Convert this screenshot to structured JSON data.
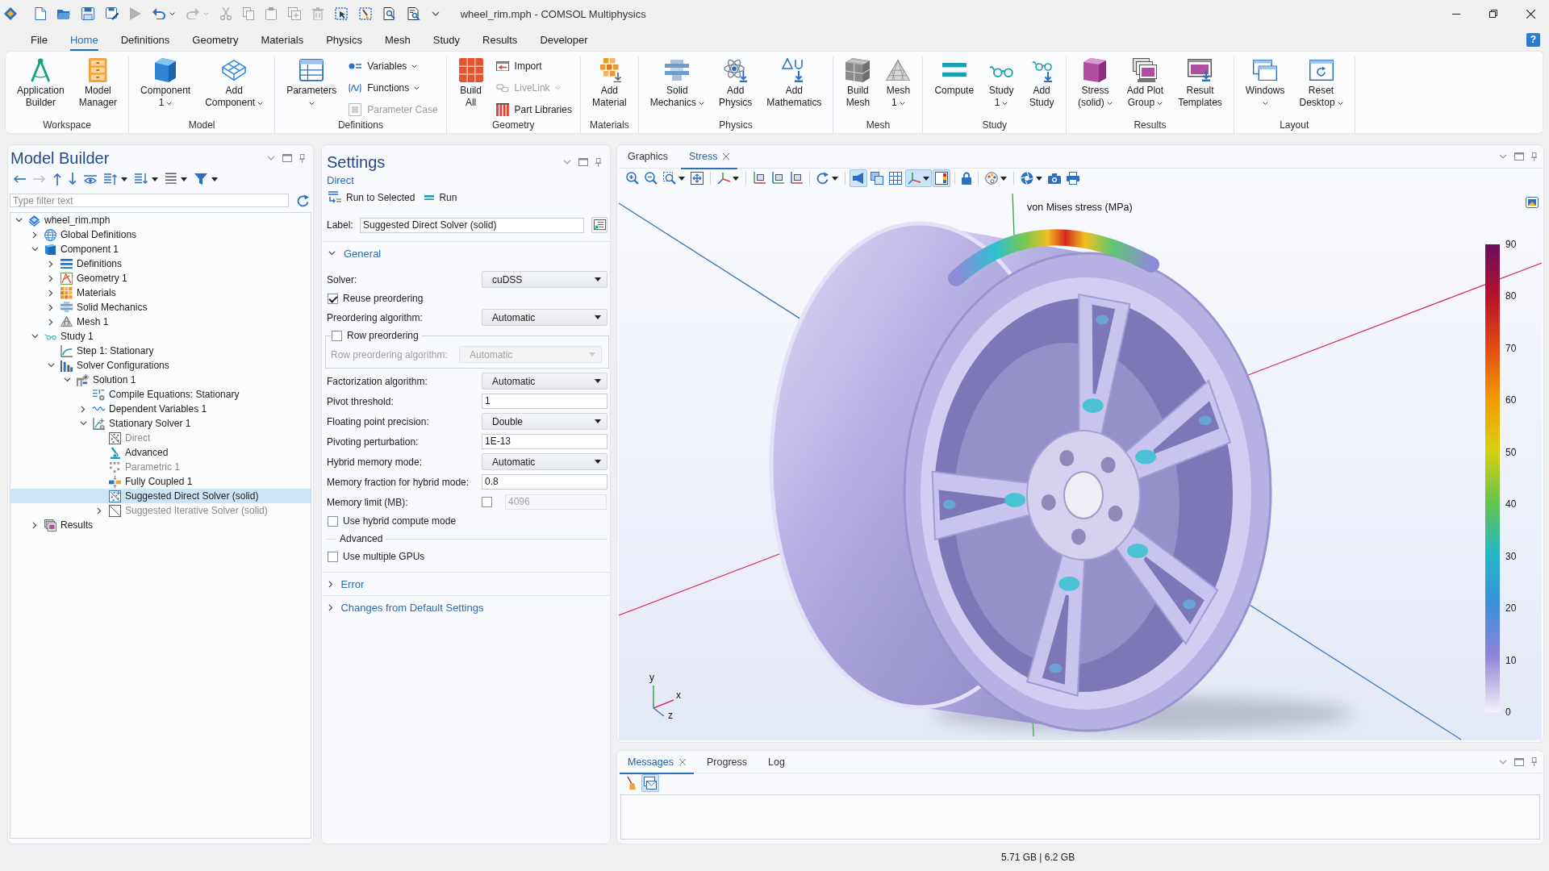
{
  "window": {
    "title": "wheel_rim.mph - COMSOL Multiphysics"
  },
  "quick_access": [
    {
      "kind": "new",
      "disabled": false
    },
    {
      "kind": "open",
      "disabled": false
    },
    {
      "kind": "save",
      "disabled": false
    },
    {
      "kind": "save_as",
      "disabled": false
    },
    {
      "kind": "run",
      "disabled": true
    },
    {
      "kind": "undo",
      "disabled": false,
      "menu": true
    },
    {
      "kind": "redo",
      "disabled": true,
      "menu": true
    },
    {
      "kind": "cut",
      "disabled": true
    },
    {
      "kind": "copy",
      "disabled": true
    },
    {
      "kind": "paste",
      "disabled": true
    },
    {
      "kind": "duplicate",
      "disabled": true
    },
    {
      "kind": "delete",
      "disabled": true
    },
    {
      "kind": "select_box",
      "disabled": false
    },
    {
      "kind": "brush_box",
      "disabled": false
    },
    {
      "kind": "find",
      "disabled": false
    },
    {
      "kind": "find_list",
      "disabled": false
    },
    {
      "kind": "customize",
      "disabled": false
    }
  ],
  "menu_tabs": [
    {
      "label": "File",
      "selected": false
    },
    {
      "label": "Home",
      "selected": true
    },
    {
      "label": "Definitions",
      "selected": false
    },
    {
      "label": "Geometry",
      "selected": false
    },
    {
      "label": "Materials",
      "selected": false
    },
    {
      "label": "Physics",
      "selected": false
    },
    {
      "label": "Mesh",
      "selected": false
    },
    {
      "label": "Study",
      "selected": false
    },
    {
      "label": "Results",
      "selected": false
    },
    {
      "label": "Developer",
      "selected": false
    }
  ],
  "help": "?",
  "ribbon": {
    "groups": [
      {
        "label": "Workspace",
        "buttons": [
          {
            "kind": "app_builder",
            "lines": [
              "Application",
              "Builder"
            ]
          },
          {
            "kind": "model_manager",
            "lines": [
              "Model",
              "Manager"
            ]
          }
        ]
      },
      {
        "label": "Model",
        "buttons": [
          {
            "kind": "component",
            "lines": [
              "Component",
              "1"
            ],
            "menu": true
          },
          {
            "kind": "add_component",
            "lines": [
              "Add",
              "Component"
            ],
            "menu": true
          }
        ]
      },
      {
        "label": "Definitions",
        "buttons": [
          {
            "kind": "parameters",
            "lines": [
              "Parameters"
            ],
            "menu": true
          }
        ],
        "small": [
          {
            "kind": "variables",
            "label": "Variables",
            "menu": true,
            "disabled": false
          },
          {
            "kind": "functions",
            "label": "Functions",
            "menu": true,
            "disabled": false
          },
          {
            "kind": "parameter_case",
            "label": "Parameter Case",
            "disabled": true
          }
        ]
      },
      {
        "label": "Geometry",
        "buttons": [
          {
            "kind": "build_all",
            "lines": [
              "Build",
              "All"
            ]
          }
        ],
        "small": [
          {
            "kind": "import",
            "label": "Import",
            "disabled": false
          },
          {
            "kind": "livelink",
            "label": "LiveLink",
            "menu": true,
            "disabled": true
          },
          {
            "kind": "part_libraries",
            "label": "Part Libraries",
            "disabled": false
          }
        ]
      },
      {
        "label": "Materials",
        "buttons": [
          {
            "kind": "add_material",
            "lines": [
              "Add",
              "Material"
            ]
          }
        ]
      },
      {
        "label": "Physics",
        "buttons": [
          {
            "kind": "solid_mechanics",
            "lines": [
              "Solid",
              "Mechanics"
            ],
            "menu": true
          },
          {
            "kind": "add_physics",
            "lines": [
              "Add",
              "Physics"
            ]
          },
          {
            "kind": "add_mathematics",
            "lines": [
              "Add",
              "Mathematics"
            ]
          }
        ]
      },
      {
        "label": "Mesh",
        "buttons": [
          {
            "kind": "build_mesh",
            "lines": [
              "Build",
              "Mesh"
            ]
          },
          {
            "kind": "mesh",
            "lines": [
              "Mesh",
              "1"
            ],
            "menu": true
          }
        ]
      },
      {
        "label": "Study",
        "buttons": [
          {
            "kind": "compute",
            "lines": [
              "Compute"
            ]
          },
          {
            "kind": "study",
            "lines": [
              "Study",
              "1"
            ],
            "menu": true
          },
          {
            "kind": "add_study",
            "lines": [
              "Add",
              "Study"
            ]
          }
        ]
      },
      {
        "label": "Results",
        "buttons": [
          {
            "kind": "plot_group",
            "lines": [
              "Stress",
              "(solid)"
            ],
            "menu": true
          },
          {
            "kind": "add_plot_group",
            "lines": [
              "Add Plot",
              "Group"
            ],
            "menu": true
          },
          {
            "kind": "result_templates",
            "lines": [
              "Result",
              "Templates"
            ]
          }
        ]
      },
      {
        "label": "Layout",
        "buttons": [
          {
            "kind": "windows",
            "lines": [
              "Windows"
            ],
            "menu": true
          },
          {
            "kind": "reset_desktop",
            "lines": [
              "Reset",
              "Desktop"
            ],
            "menu": true
          }
        ]
      }
    ]
  },
  "model_builder": {
    "title": "Model Builder",
    "toolbar": [
      {
        "kind": "back",
        "disabled": false
      },
      {
        "kind": "forward",
        "disabled": true
      },
      {
        "kind": "move_up",
        "disabled": false
      },
      {
        "kind": "move_down",
        "disabled": false
      },
      {
        "kind": "show",
        "disabled": false
      },
      {
        "kind": "collapse",
        "disabled": false,
        "menu": true
      },
      {
        "kind": "expand",
        "disabled": false,
        "menu": true
      },
      {
        "kind": "list",
        "disabled": false,
        "menu": true
      },
      {
        "kind": "filter",
        "disabled": false,
        "menu": true
      }
    ],
    "filter": {
      "placeholder": "Type filter text"
    },
    "tree": [
      {
        "label": "wheel_rim.mph",
        "kind": "root",
        "expanded": true,
        "selected": false,
        "disabled": false,
        "children": [
          {
            "label": "Global Definitions",
            "kind": "global",
            "expanded": false,
            "selected": false,
            "disabled": false
          },
          {
            "label": "Component 1",
            "kind": "component",
            "expanded": true,
            "selected": false,
            "disabled": false,
            "children": [
              {
                "label": "Definitions",
                "kind": "definitions",
                "expanded": false,
                "selected": false,
                "disabled": false
              },
              {
                "label": "Geometry 1",
                "kind": "geometry",
                "expanded": false,
                "selected": false,
                "disabled": false
              },
              {
                "label": "Materials",
                "kind": "materials",
                "expanded": false,
                "selected": false,
                "disabled": false
              },
              {
                "label": "Solid Mechanics",
                "kind": "physics",
                "expanded": false,
                "selected": false,
                "disabled": false
              },
              {
                "label": "Mesh 1",
                "kind": "mesh",
                "expanded": false,
                "selected": false,
                "disabled": false
              }
            ]
          },
          {
            "label": "Study 1",
            "kind": "study",
            "expanded": true,
            "selected": false,
            "disabled": false,
            "children": [
              {
                "label": "Step 1: Stationary",
                "kind": "step",
                "selected": false,
                "disabled": false
              },
              {
                "label": "Solver Configurations",
                "kind": "solver_configurations",
                "expanded": true,
                "selected": false,
                "disabled": false,
                "children": [
                  {
                    "label": "Solution 1",
                    "kind": "solution",
                    "expanded": true,
                    "selected": false,
                    "disabled": false,
                    "children": [
                      {
                        "label": "Compile Equations: Stationary",
                        "kind": "compile",
                        "selected": false,
                        "disabled": false
                      },
                      {
                        "label": "Dependent Variables 1",
                        "kind": "variables",
                        "expanded": false,
                        "selected": false,
                        "disabled": false
                      },
                      {
                        "label": "Stationary Solver 1",
                        "kind": "stationary_solver",
                        "expanded": true,
                        "selected": false,
                        "disabled": false,
                        "children": [
                          {
                            "label": "Direct",
                            "kind": "direct",
                            "selected": false,
                            "disabled": true
                          },
                          {
                            "label": "Advanced",
                            "kind": "advanced",
                            "selected": false,
                            "disabled": false
                          },
                          {
                            "label": "Parametric 1",
                            "kind": "parametric",
                            "selected": false,
                            "disabled": true
                          },
                          {
                            "label": "Fully Coupled 1",
                            "kind": "fully_coupled",
                            "selected": false,
                            "disabled": false
                          },
                          {
                            "label": "Suggested Direct Solver (solid)",
                            "kind": "direct_suggested",
                            "selected": true,
                            "disabled": false
                          },
                          {
                            "label": "Suggested Iterative Solver (solid)",
                            "kind": "iterative",
                            "expanded": false,
                            "selected": false,
                            "disabled": true
                          }
                        ]
                      }
                    ]
                  }
                ]
              }
            ]
          },
          {
            "label": "Results",
            "kind": "results",
            "expanded": false,
            "selected": false,
            "disabled": false
          }
        ]
      }
    ]
  },
  "settings": {
    "title": "Settings",
    "node": "Direct",
    "actions": [
      {
        "kind": "run_selected",
        "label": "Run to Selected"
      },
      {
        "kind": "run",
        "label": "Run"
      }
    ],
    "label_field": {
      "label": "Label:",
      "value": "Suggested Direct Solver (solid)"
    },
    "sections": [
      {
        "title": "General",
        "expanded": true,
        "rows": [
          {
            "kind": "select",
            "label": "Solver:",
            "value": "cuDSS",
            "disabled": false
          },
          {
            "kind": "checkbox",
            "label": "Reuse preordering",
            "checked": true
          },
          {
            "kind": "select",
            "label": "Preordering algorithm:",
            "value": "Automatic",
            "disabled": false
          },
          {
            "kind": "group",
            "label": "Row preordering",
            "checked": false,
            "rows": [
              {
                "kind": "select",
                "label": "Row preordering algorithm:",
                "value": "Automatic",
                "disabled": true
              }
            ]
          },
          {
            "kind": "select",
            "label": "Factorization algorithm:",
            "value": "Automatic",
            "disabled": false
          },
          {
            "kind": "text",
            "label": "Pivot threshold:",
            "value": "1",
            "disabled": false
          },
          {
            "kind": "select",
            "label": "Floating point precision:",
            "value": "Double",
            "disabled": false
          },
          {
            "kind": "text",
            "label": "Pivoting perturbation:",
            "value": "1E-13",
            "disabled": false
          },
          {
            "kind": "select",
            "label": "Hybrid memory mode:",
            "value": "Automatic",
            "disabled": false
          },
          {
            "kind": "text",
            "label": "Memory fraction for hybrid mode:",
            "value": "0.8",
            "disabled": false
          },
          {
            "kind": "checked_text",
            "label": "Memory limit (MB):",
            "checked": false,
            "value": "4096",
            "disabled": true
          },
          {
            "kind": "checkbox",
            "label": "Use hybrid compute mode",
            "checked": false
          },
          {
            "kind": "heading",
            "label": "Advanced"
          },
          {
            "kind": "checkbox",
            "label": "Use multiple GPUs",
            "checked": false
          }
        ]
      },
      {
        "title": "Error",
        "expanded": false
      },
      {
        "title": "Changes from Default Settings",
        "expanded": false
      }
    ]
  },
  "graphics": {
    "tabs": [
      {
        "label": "Graphics",
        "selected": false
      },
      {
        "label": "Stress",
        "selected": true,
        "closable": true
      }
    ],
    "toolbar": [
      [
        {
          "kind": "zoom_in",
          "on": false
        },
        {
          "kind": "zoom_out",
          "on": false
        },
        {
          "kind": "zoom_box",
          "on": false,
          "menu": true
        },
        {
          "kind": "zoom_extents",
          "on": false
        }
      ],
      [
        {
          "kind": "view_direction",
          "on": false,
          "menu": true
        }
      ],
      [
        {
          "kind": "xy_view",
          "on": false
        },
        {
          "kind": "yz_view",
          "on": false
        },
        {
          "kind": "xz_view",
          "on": false
        }
      ],
      [
        {
          "kind": "rotate",
          "on": false,
          "menu": true
        }
      ],
      [
        {
          "kind": "scene_light",
          "on": true
        },
        {
          "kind": "transparency",
          "on": false
        },
        {
          "kind": "grid",
          "on": false
        },
        {
          "kind": "axes",
          "on": true,
          "menu": true
        },
        {
          "kind": "legend",
          "on": true
        }
      ],
      [
        {
          "kind": "lock",
          "on": false
        }
      ],
      [
        {
          "kind": "palette",
          "on": false,
          "menu": true
        }
      ],
      [
        {
          "kind": "render",
          "on": false,
          "menu": true
        },
        {
          "kind": "screenshot",
          "on": false
        },
        {
          "kind": "print",
          "on": false
        }
      ]
    ],
    "plot_title": "von Mises stress (MPa)",
    "color_legend": {
      "ticks": [
        "90",
        "80",
        "70",
        "60",
        "50",
        "40",
        "30",
        "20",
        "10",
        "0"
      ]
    },
    "axis_labels": [
      "y",
      "x",
      "z"
    ]
  },
  "messages": {
    "tabs": [
      {
        "label": "Messages",
        "selected": true,
        "closable": true
      },
      {
        "label": "Progress",
        "selected": false
      },
      {
        "label": "Log",
        "selected": false
      }
    ],
    "toolbar": [
      {
        "kind": "clear",
        "on": false
      },
      {
        "kind": "show_messages",
        "on": true
      }
    ]
  },
  "status_bar": {
    "memory": "5.71 GB | 6.2 GB"
  }
}
